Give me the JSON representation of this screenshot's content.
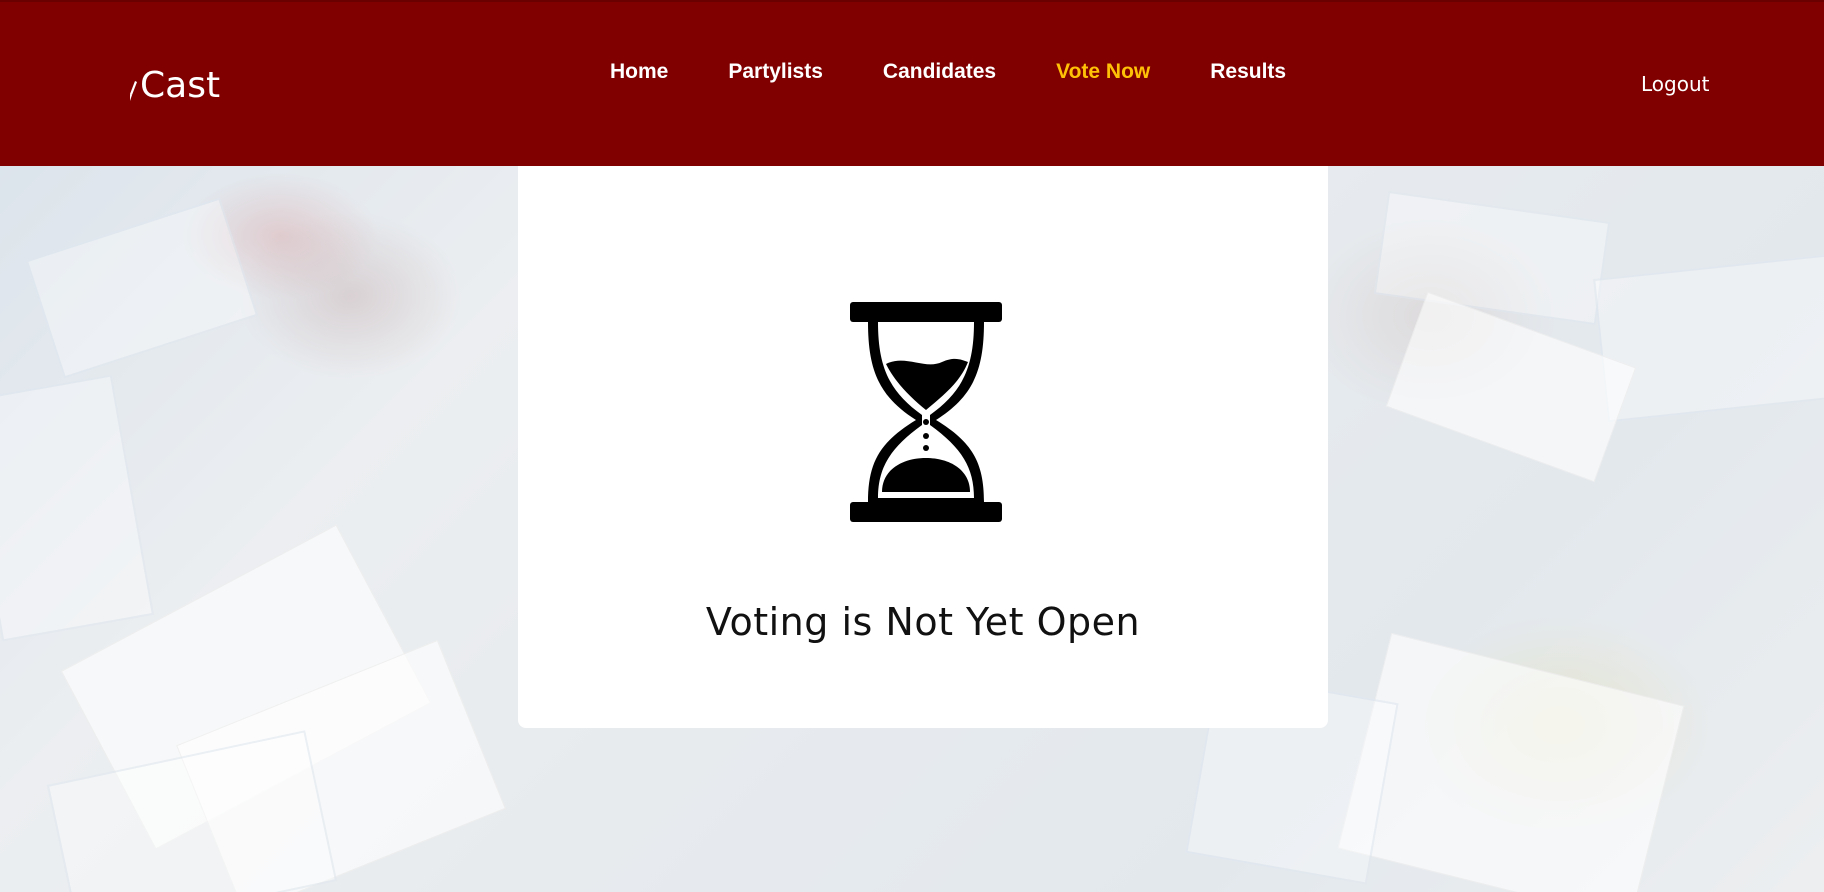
{
  "brand": {
    "name": "Cast",
    "logo_icon": "pen-nib-icon"
  },
  "nav": {
    "links": [
      {
        "label": "Home"
      },
      {
        "label": "Partylists"
      },
      {
        "label": "Candidates"
      },
      {
        "label": "Vote Now",
        "active": true
      },
      {
        "label": "Results"
      }
    ],
    "logout_label": "Logout"
  },
  "status": {
    "icon": "hourglass-icon",
    "message": "Voting is Not Yet Open"
  },
  "colors": {
    "navbar": "#800000",
    "active_link": "#ffc107",
    "card": "#ffffff",
    "text": "#111111"
  }
}
